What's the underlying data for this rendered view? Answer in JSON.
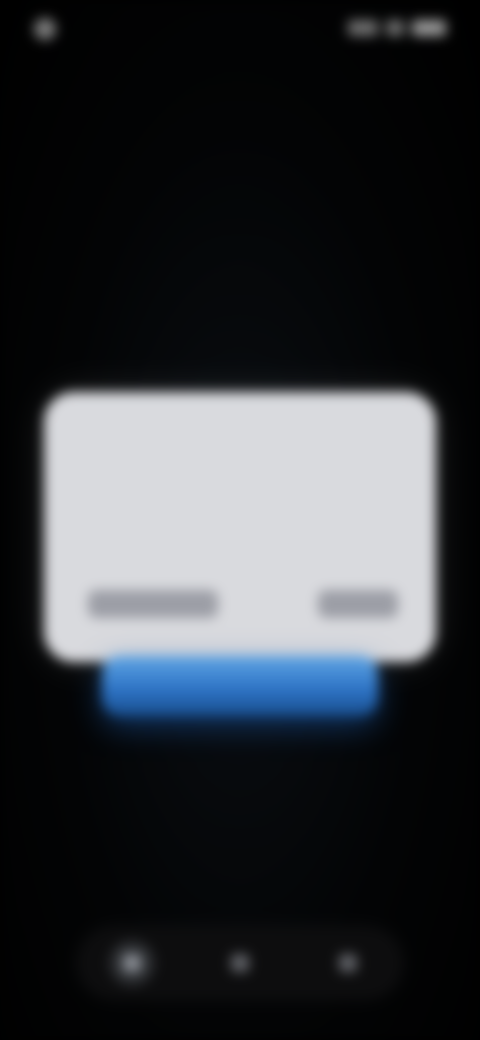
{
  "status_bar": {
    "time": "",
    "icons": [
      "signal-icon",
      "wifi-icon",
      "battery-icon"
    ]
  },
  "header": {
    "title": ""
  },
  "dialog": {
    "title": "",
    "body": "",
    "actions": [
      {
        "label": ""
      },
      {
        "label": ""
      }
    ]
  },
  "primary_action": {
    "label": ""
  },
  "bottom_nav": {
    "items": [
      {
        "icon": "home-icon",
        "active": true
      },
      {
        "icon": "grid-icon",
        "active": false
      },
      {
        "icon": "person-icon",
        "active": false
      }
    ]
  },
  "colors": {
    "background": "#000000",
    "dialog": "#d9dade",
    "accent": "#2e74c6"
  }
}
